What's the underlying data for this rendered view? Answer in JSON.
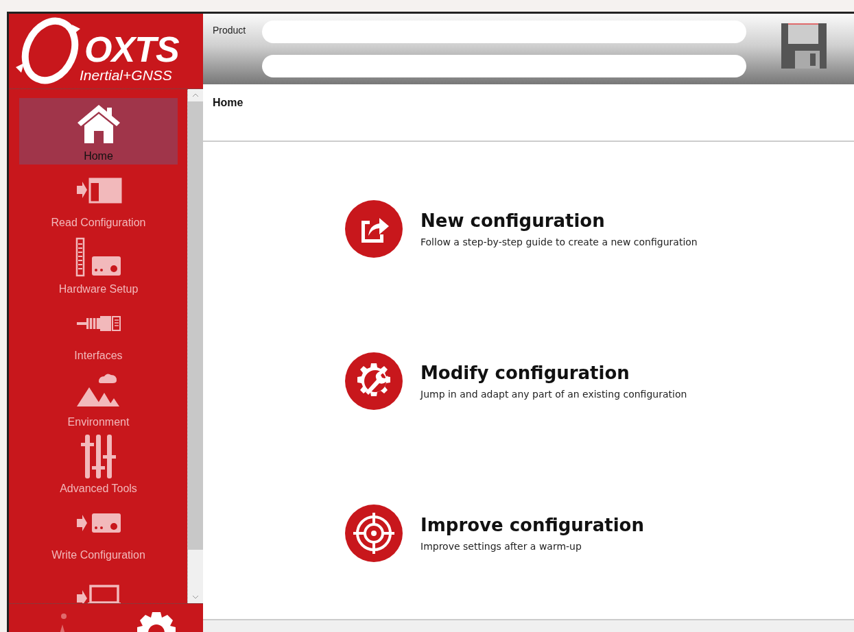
{
  "logo": {
    "name": "OXTS",
    "tagline": "Inertial+GNSS"
  },
  "header": {
    "product_label": "Product"
  },
  "sidebar": {
    "items": [
      {
        "kind": "home",
        "label": "Home",
        "selected": true
      },
      {
        "kind": "read",
        "label": "Read Configuration",
        "selected": false
      },
      {
        "kind": "hardware",
        "label": "Hardware Setup",
        "selected": false
      },
      {
        "kind": "interfaces",
        "label": "Interfaces",
        "selected": false
      },
      {
        "kind": "environment",
        "label": "Environment",
        "selected": false
      },
      {
        "kind": "advanced",
        "label": "Advanced Tools",
        "selected": false
      },
      {
        "kind": "write",
        "label": "Write Configuration",
        "selected": false
      },
      {
        "kind": "export",
        "selected": false
      }
    ]
  },
  "page": {
    "title": "Home"
  },
  "actions": [
    {
      "kind": "new",
      "title": "New configuration",
      "description": "Follow a step-by-step guide to create a new configuration"
    },
    {
      "kind": "modify",
      "title": "Modify configuration",
      "description": "Jump in and adapt any part of an existing configuration"
    },
    {
      "kind": "improve",
      "title": "Improve configuration",
      "description": "Improve settings after a warm-up"
    }
  ]
}
